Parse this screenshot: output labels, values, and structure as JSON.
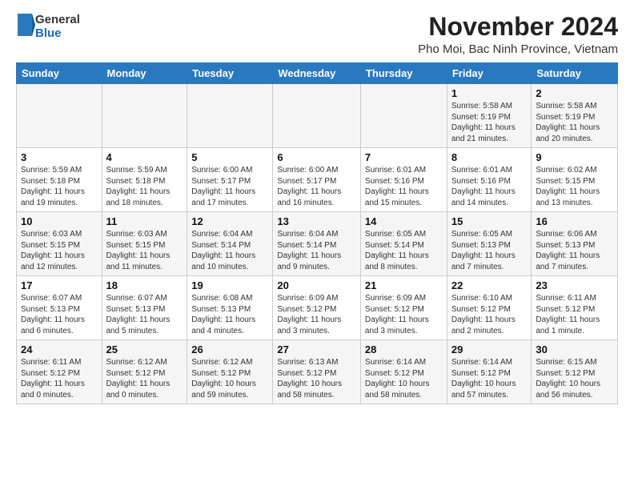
{
  "header": {
    "logo_general": "General",
    "logo_blue": "Blue",
    "month_year": "November 2024",
    "location": "Pho Moi, Bac Ninh Province, Vietnam"
  },
  "weekdays": [
    "Sunday",
    "Monday",
    "Tuesday",
    "Wednesday",
    "Thursday",
    "Friday",
    "Saturday"
  ],
  "weeks": [
    [
      {
        "day": "",
        "info": ""
      },
      {
        "day": "",
        "info": ""
      },
      {
        "day": "",
        "info": ""
      },
      {
        "day": "",
        "info": ""
      },
      {
        "day": "",
        "info": ""
      },
      {
        "day": "1",
        "info": "Sunrise: 5:58 AM\nSunset: 5:19 PM\nDaylight: 11 hours\nand 21 minutes."
      },
      {
        "day": "2",
        "info": "Sunrise: 5:58 AM\nSunset: 5:19 PM\nDaylight: 11 hours\nand 20 minutes."
      }
    ],
    [
      {
        "day": "3",
        "info": "Sunrise: 5:59 AM\nSunset: 5:18 PM\nDaylight: 11 hours\nand 19 minutes."
      },
      {
        "day": "4",
        "info": "Sunrise: 5:59 AM\nSunset: 5:18 PM\nDaylight: 11 hours\nand 18 minutes."
      },
      {
        "day": "5",
        "info": "Sunrise: 6:00 AM\nSunset: 5:17 PM\nDaylight: 11 hours\nand 17 minutes."
      },
      {
        "day": "6",
        "info": "Sunrise: 6:00 AM\nSunset: 5:17 PM\nDaylight: 11 hours\nand 16 minutes."
      },
      {
        "day": "7",
        "info": "Sunrise: 6:01 AM\nSunset: 5:16 PM\nDaylight: 11 hours\nand 15 minutes."
      },
      {
        "day": "8",
        "info": "Sunrise: 6:01 AM\nSunset: 5:16 PM\nDaylight: 11 hours\nand 14 minutes."
      },
      {
        "day": "9",
        "info": "Sunrise: 6:02 AM\nSunset: 5:15 PM\nDaylight: 11 hours\nand 13 minutes."
      }
    ],
    [
      {
        "day": "10",
        "info": "Sunrise: 6:03 AM\nSunset: 5:15 PM\nDaylight: 11 hours\nand 12 minutes."
      },
      {
        "day": "11",
        "info": "Sunrise: 6:03 AM\nSunset: 5:15 PM\nDaylight: 11 hours\nand 11 minutes."
      },
      {
        "day": "12",
        "info": "Sunrise: 6:04 AM\nSunset: 5:14 PM\nDaylight: 11 hours\nand 10 minutes."
      },
      {
        "day": "13",
        "info": "Sunrise: 6:04 AM\nSunset: 5:14 PM\nDaylight: 11 hours\nand 9 minutes."
      },
      {
        "day": "14",
        "info": "Sunrise: 6:05 AM\nSunset: 5:14 PM\nDaylight: 11 hours\nand 8 minutes."
      },
      {
        "day": "15",
        "info": "Sunrise: 6:05 AM\nSunset: 5:13 PM\nDaylight: 11 hours\nand 7 minutes."
      },
      {
        "day": "16",
        "info": "Sunrise: 6:06 AM\nSunset: 5:13 PM\nDaylight: 11 hours\nand 7 minutes."
      }
    ],
    [
      {
        "day": "17",
        "info": "Sunrise: 6:07 AM\nSunset: 5:13 PM\nDaylight: 11 hours\nand 6 minutes."
      },
      {
        "day": "18",
        "info": "Sunrise: 6:07 AM\nSunset: 5:13 PM\nDaylight: 11 hours\nand 5 minutes."
      },
      {
        "day": "19",
        "info": "Sunrise: 6:08 AM\nSunset: 5:13 PM\nDaylight: 11 hours\nand 4 minutes."
      },
      {
        "day": "20",
        "info": "Sunrise: 6:09 AM\nSunset: 5:12 PM\nDaylight: 11 hours\nand 3 minutes."
      },
      {
        "day": "21",
        "info": "Sunrise: 6:09 AM\nSunset: 5:12 PM\nDaylight: 11 hours\nand 3 minutes."
      },
      {
        "day": "22",
        "info": "Sunrise: 6:10 AM\nSunset: 5:12 PM\nDaylight: 11 hours\nand 2 minutes."
      },
      {
        "day": "23",
        "info": "Sunrise: 6:11 AM\nSunset: 5:12 PM\nDaylight: 11 hours\nand 1 minute."
      }
    ],
    [
      {
        "day": "24",
        "info": "Sunrise: 6:11 AM\nSunset: 5:12 PM\nDaylight: 11 hours\nand 0 minutes."
      },
      {
        "day": "25",
        "info": "Sunrise: 6:12 AM\nSunset: 5:12 PM\nDaylight: 11 hours\nand 0 minutes."
      },
      {
        "day": "26",
        "info": "Sunrise: 6:12 AM\nSunset: 5:12 PM\nDaylight: 10 hours\nand 59 minutes."
      },
      {
        "day": "27",
        "info": "Sunrise: 6:13 AM\nSunset: 5:12 PM\nDaylight: 10 hours\nand 58 minutes."
      },
      {
        "day": "28",
        "info": "Sunrise: 6:14 AM\nSunset: 5:12 PM\nDaylight: 10 hours\nand 58 minutes."
      },
      {
        "day": "29",
        "info": "Sunrise: 6:14 AM\nSunset: 5:12 PM\nDaylight: 10 hours\nand 57 minutes."
      },
      {
        "day": "30",
        "info": "Sunrise: 6:15 AM\nSunset: 5:12 PM\nDaylight: 10 hours\nand 56 minutes."
      }
    ]
  ]
}
